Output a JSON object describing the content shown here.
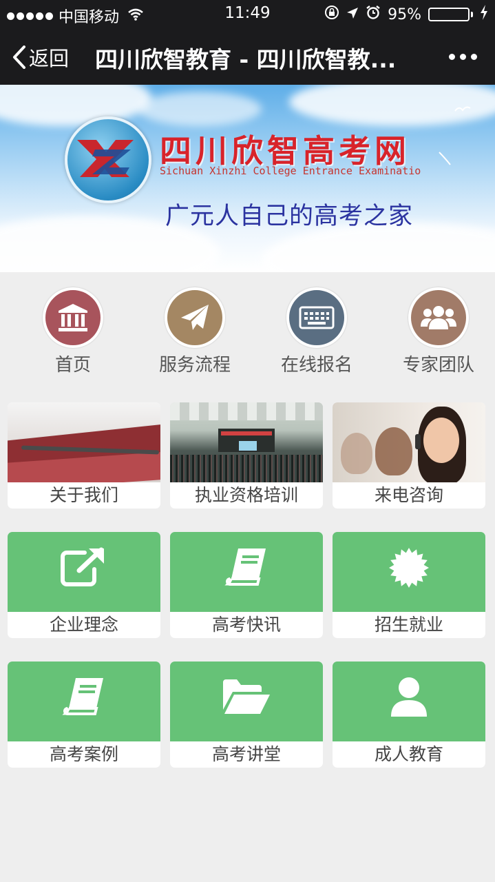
{
  "status_bar": {
    "carrier": "中国移动",
    "time": "11:49",
    "battery_percent": "95%",
    "battery_level": 0.95,
    "icons": [
      "signal-dots-icon",
      "wifi-icon",
      "rotation-lock-icon",
      "location-arrow-icon",
      "alarm-icon",
      "battery-icon",
      "charging-bolt-icon"
    ]
  },
  "nav": {
    "back_label": "返回",
    "title": "四川欣智教育 - 四川欣智教..."
  },
  "banner": {
    "title": "四川欣智高考网",
    "subtitle": "Sichuan Xinzhi College Entrance Examinatio",
    "slogan": "广元人自己的高考之家"
  },
  "quick_nav": [
    {
      "label": "首页",
      "icon": "bank-icon",
      "color": "#a8545c"
    },
    {
      "label": "服务流程",
      "icon": "paper-plane-icon",
      "color": "#a48763"
    },
    {
      "label": "在线报名",
      "icon": "keyboard-icon",
      "color": "#5a6e82"
    },
    {
      "label": "专家团队",
      "icon": "users-icon",
      "color": "#a17b68"
    }
  ],
  "photo_cards": [
    {
      "label": "关于我们"
    },
    {
      "label": "执业资格培训"
    },
    {
      "label": "来电咨询"
    }
  ],
  "icon_cards": [
    {
      "label": "企业理念",
      "icon": "external-link-icon"
    },
    {
      "label": "高考快讯",
      "icon": "book-icon"
    },
    {
      "label": "招生就业",
      "icon": "certificate-icon"
    },
    {
      "label": "高考案例",
      "icon": "book-icon"
    },
    {
      "label": "高考讲堂",
      "icon": "folder-open-icon"
    },
    {
      "label": "成人教育",
      "icon": "user-icon"
    }
  ],
  "colors": {
    "tile_green": "#66c277",
    "bar_dark": "#1b1b1d",
    "background": "#eeeeee"
  }
}
